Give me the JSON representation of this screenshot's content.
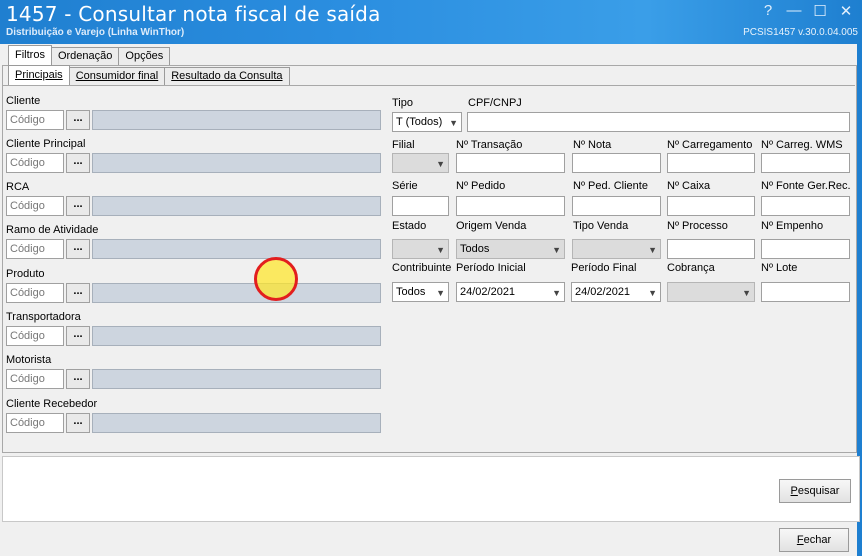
{
  "window": {
    "title": "1457 - Consultar nota fiscal de saída",
    "subtitle": "Distribuição e Varejo (Linha WinThor)",
    "version": "PCSIS1457  v.30.0.04.005",
    "buttons": {
      "help": "?",
      "minimize": "—",
      "maximize": "☐",
      "close": "✕"
    }
  },
  "top_tabs": [
    {
      "label": "Filtros",
      "active": true
    },
    {
      "label": "Ordenação",
      "active": false
    },
    {
      "label": "Opções",
      "active": false
    }
  ],
  "sub_tabs": [
    {
      "label": "Principais",
      "active": true
    },
    {
      "label": "Consumidor final",
      "active": false
    },
    {
      "label": "Resultado da Consulta",
      "active": false
    }
  ],
  "lookup_fields": [
    {
      "label": "Cliente",
      "placeholder": "Código",
      "button": "..."
    },
    {
      "label": "Cliente Principal",
      "placeholder": "Código",
      "button": "..."
    },
    {
      "label": "RCA",
      "placeholder": "Código",
      "button": "..."
    },
    {
      "label": "Ramo de Atividade",
      "placeholder": "Código",
      "button": "..."
    },
    {
      "label": "Produto",
      "placeholder": "Código",
      "button": "..."
    },
    {
      "label": "Transportadora",
      "placeholder": "Código",
      "button": "..."
    },
    {
      "label": "Motorista",
      "placeholder": "Código",
      "button": "..."
    },
    {
      "label": "Cliente Recebedor",
      "placeholder": "Código",
      "button": "..."
    }
  ],
  "right": {
    "tipo": {
      "label": "Tipo",
      "value": "T (Todos)"
    },
    "cpf": {
      "label": "CPF/CNPJ",
      "value": ""
    },
    "row2": {
      "filial": "Filial",
      "transacao": "Nº Transação",
      "nota": "Nº Nota",
      "carregamento": "Nº Carregamento",
      "carreg_wms": "Nº Carreg. WMS"
    },
    "row3": {
      "serie": "Série",
      "pedido": "Nº Pedido",
      "ped_cliente": "Nº Ped. Cliente",
      "caixa": "Nº Caixa",
      "fonte": "Nº Fonte Ger.Rec."
    },
    "row4": {
      "estado": "Estado",
      "origem": "Origem Venda",
      "origem_value": "Todos",
      "tipo_venda": "Tipo Venda",
      "processo": "Nº Processo",
      "empenho": "Nº Empenho"
    },
    "row5": {
      "contribuinte": "Contribuinte",
      "contribuinte_value": "Todos",
      "periodo_inicial": "Período Inicial",
      "periodo_inicial_value": "24/02/2021",
      "periodo_final": "Período Final",
      "periodo_final_value": "24/02/2021",
      "cobranca": "Cobrança",
      "lote": "Nº Lote"
    }
  },
  "buttons": {
    "pesquisar_u": "P",
    "pesquisar_rest": "esquisar",
    "fechar_u": "F",
    "fechar_rest": "echar"
  },
  "colors": {
    "titlebar": "#2b8ee0",
    "readonly_field": "#cdd5df",
    "cursor_ring": "#e21e1e"
  }
}
